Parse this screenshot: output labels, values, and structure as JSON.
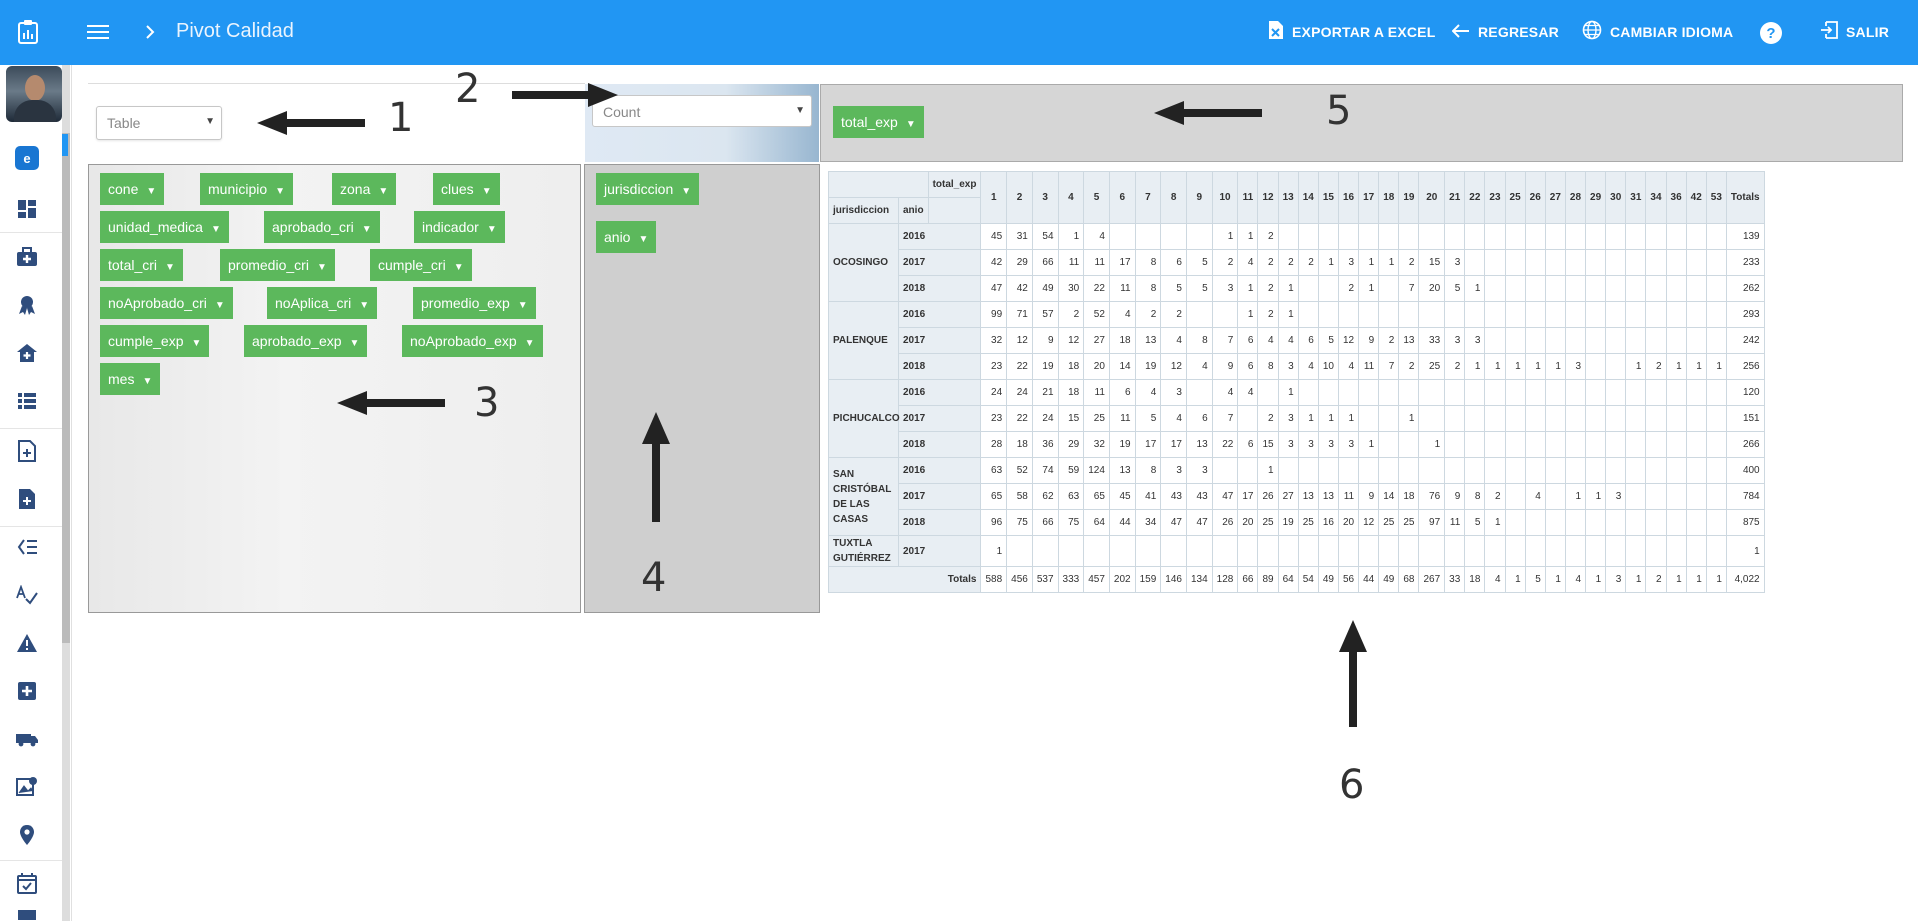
{
  "topbar": {
    "app_icon": "clipboard-chart-icon",
    "menu_icon": "hamburger-menu-icon",
    "breadcrumb_icon": "chevron-right-icon",
    "title": "Pivot Calidad",
    "export_label": "EXPORTAR A EXCEL",
    "back_label": "REGRESAR",
    "language_label": "CAMBIAR IDIOMA",
    "help_label": "?",
    "logout_label": "SALIR"
  },
  "sidebar": {
    "badge_label": "e",
    "items": [
      "dashboard-icon",
      "first-aid-kit-icon",
      "award-icon",
      "clinic-icon",
      "list-icon",
      "add-document-icon",
      "document-plus-icon",
      "checklist-icon",
      "spellcheck-icon",
      "warning-icon",
      "medical-plus-icon",
      "ambulance-icon",
      "map-photo-icon",
      "location-pin-icon",
      "calendar-check-icon"
    ]
  },
  "annotations": [
    "1",
    "2",
    "3",
    "4",
    "5",
    "6"
  ],
  "pivot": {
    "renderer": "Table",
    "aggregator": "Count",
    "unused_fields": [
      "cone",
      "municipio",
      "zona",
      "clues",
      "unidad_medica",
      "aprobado_cri",
      "indicador",
      "total_cri",
      "promedio_cri",
      "cumple_cri",
      "noAprobado_cri",
      "noAplica_cri",
      "promedio_exp",
      "cumple_exp",
      "aprobado_exp",
      "noAprobado_exp",
      "mes"
    ],
    "row_fields": [
      "jurisdiccion",
      "anio"
    ],
    "col_fields": [
      "total_exp"
    ],
    "table": {
      "col_attr": "total_exp",
      "row_attr1": "jurisdiccion",
      "row_attr2": "anio",
      "columns": [
        "1",
        "2",
        "3",
        "4",
        "5",
        "6",
        "7",
        "8",
        "9",
        "10",
        "11",
        "12",
        "13",
        "14",
        "15",
        "16",
        "17",
        "18",
        "19",
        "20",
        "21",
        "22",
        "23",
        "25",
        "26",
        "27",
        "28",
        "29",
        "30",
        "31",
        "34",
        "36",
        "42",
        "53"
      ],
      "totals_label": "Totals",
      "groups": [
        {
          "name": "OCOSINGO",
          "rows": [
            {
              "year": "2016",
              "cells": [
                "45",
                "31",
                "54",
                "1",
                "4",
                "",
                "",
                "",
                "",
                "1",
                "1",
                "2",
                "",
                "",
                "",
                "",
                "",
                "",
                "",
                "",
                "",
                "",
                "",
                "",
                "",
                "",
                "",
                "",
                "",
                "",
                "",
                "",
                "",
                ""
              ],
              "total": "139"
            },
            {
              "year": "2017",
              "cells": [
                "42",
                "29",
                "66",
                "11",
                "11",
                "17",
                "8",
                "6",
                "5",
                "2",
                "4",
                "2",
                "2",
                "2",
                "1",
                "3",
                "1",
                "1",
                "2",
                "15",
                "3",
                "",
                "",
                "",
                "",
                "",
                "",
                "",
                "",
                "",
                "",
                "",
                "",
                ""
              ],
              "total": "233"
            },
            {
              "year": "2018",
              "cells": [
                "47",
                "42",
                "49",
                "30",
                "22",
                "11",
                "8",
                "5",
                "5",
                "3",
                "1",
                "2",
                "1",
                "",
                "",
                "2",
                "1",
                "",
                "7",
                "20",
                "5",
                "1",
                "",
                "",
                "",
                "",
                "",
                "",
                "",
                "",
                "",
                "",
                "",
                ""
              ],
              "total": "262"
            }
          ]
        },
        {
          "name": "PALENQUE",
          "rows": [
            {
              "year": "2016",
              "cells": [
                "99",
                "71",
                "57",
                "2",
                "52",
                "4",
                "2",
                "2",
                "",
                "",
                "1",
                "2",
                "1",
                "",
                "",
                "",
                "",
                "",
                "",
                "",
                "",
                "",
                "",
                "",
                "",
                "",
                "",
                "",
                "",
                "",
                "",
                "",
                "",
                ""
              ],
              "total": "293"
            },
            {
              "year": "2017",
              "cells": [
                "32",
                "12",
                "9",
                "12",
                "27",
                "18",
                "13",
                "4",
                "8",
                "7",
                "6",
                "4",
                "4",
                "6",
                "5",
                "12",
                "9",
                "2",
                "13",
                "33",
                "3",
                "3",
                "",
                "",
                "",
                "",
                "",
                "",
                "",
                "",
                "",
                "",
                "",
                ""
              ],
              "total": "242"
            },
            {
              "year": "2018",
              "cells": [
                "23",
                "22",
                "19",
                "18",
                "20",
                "14",
                "19",
                "12",
                "4",
                "9",
                "6",
                "8",
                "3",
                "4",
                "10",
                "4",
                "11",
                "7",
                "2",
                "25",
                "2",
                "1",
                "1",
                "1",
                "1",
                "1",
                "3",
                "",
                "",
                "1",
                "2",
                "1",
                "1",
                "1"
              ],
              "total": "256"
            }
          ]
        },
        {
          "name": "PICHUCALCO",
          "rows": [
            {
              "year": "2016",
              "cells": [
                "24",
                "24",
                "21",
                "18",
                "11",
                "6",
                "4",
                "3",
                "",
                "4",
                "4",
                "",
                "1",
                "",
                "",
                "",
                "",
                "",
                "",
                "",
                "",
                "",
                "",
                "",
                "",
                "",
                "",
                "",
                "",
                "",
                "",
                "",
                "",
                ""
              ],
              "total": "120"
            },
            {
              "year": "2017",
              "cells": [
                "23",
                "22",
                "24",
                "15",
                "25",
                "11",
                "5",
                "4",
                "6",
                "7",
                "",
                "2",
                "3",
                "1",
                "1",
                "1",
                "",
                "",
                "1",
                "",
                "",
                "",
                "",
                "",
                "",
                "",
                "",
                "",
                "",
                "",
                "",
                "",
                "",
                ""
              ],
              "total": "151"
            },
            {
              "year": "2018",
              "cells": [
                "28",
                "18",
                "36",
                "29",
                "32",
                "19",
                "17",
                "17",
                "13",
                "22",
                "6",
                "15",
                "3",
                "3",
                "3",
                "3",
                "1",
                "",
                "",
                "1",
                "",
                "",
                "",
                "",
                "",
                "",
                "",
                "",
                "",
                "",
                "",
                "",
                "",
                ""
              ],
              "total": "266"
            }
          ]
        },
        {
          "name": "SAN CRISTÓBAL DE LAS CASAS",
          "rows": [
            {
              "year": "2016",
              "cells": [
                "63",
                "52",
                "74",
                "59",
                "124",
                "13",
                "8",
                "3",
                "3",
                "",
                "",
                "1",
                "",
                "",
                "",
                "",
                "",
                "",
                "",
                "",
                "",
                "",
                "",
                "",
                "",
                "",
                "",
                "",
                "",
                "",
                "",
                "",
                "",
                ""
              ],
              "total": "400"
            },
            {
              "year": "2017",
              "cells": [
                "65",
                "58",
                "62",
                "63",
                "65",
                "45",
                "41",
                "43",
                "43",
                "47",
                "17",
                "26",
                "27",
                "13",
                "13",
                "11",
                "9",
                "14",
                "18",
                "76",
                "9",
                "8",
                "2",
                "",
                "4",
                "",
                "1",
                "1",
                "3",
                "",
                "",
                "",
                "",
                ""
              ],
              "total": "784"
            },
            {
              "year": "2018",
              "cells": [
                "96",
                "75",
                "66",
                "75",
                "64",
                "44",
                "34",
                "47",
                "47",
                "26",
                "20",
                "25",
                "19",
                "25",
                "16",
                "20",
                "12",
                "25",
                "25",
                "97",
                "11",
                "5",
                "1",
                "",
                "",
                "",
                "",
                "",
                "",
                "",
                "",
                "",
                "",
                ""
              ],
              "total": "875"
            }
          ]
        },
        {
          "name": "TUXTLA GUTIÉRREZ",
          "rows": [
            {
              "year": "2017",
              "cells": [
                "1",
                "",
                "",
                "",
                "",
                "",
                "",
                "",
                "",
                "",
                "",
                "",
                "",
                "",
                "",
                "",
                "",
                "",
                "",
                "",
                "",
                "",
                "",
                "",
                "",
                "",
                "",
                "",
                "",
                "",
                "",
                "",
                "",
                ""
              ],
              "total": "1"
            }
          ]
        }
      ],
      "col_totals": [
        "588",
        "456",
        "537",
        "333",
        "457",
        "202",
        "159",
        "146",
        "134",
        "128",
        "66",
        "89",
        "64",
        "54",
        "49",
        "56",
        "44",
        "49",
        "68",
        "267",
        "33",
        "18",
        "4",
        "1",
        "5",
        "1",
        "4",
        "1",
        "3",
        "1",
        "2",
        "1",
        "1",
        "1"
      ],
      "grand_total": "4,022"
    }
  }
}
